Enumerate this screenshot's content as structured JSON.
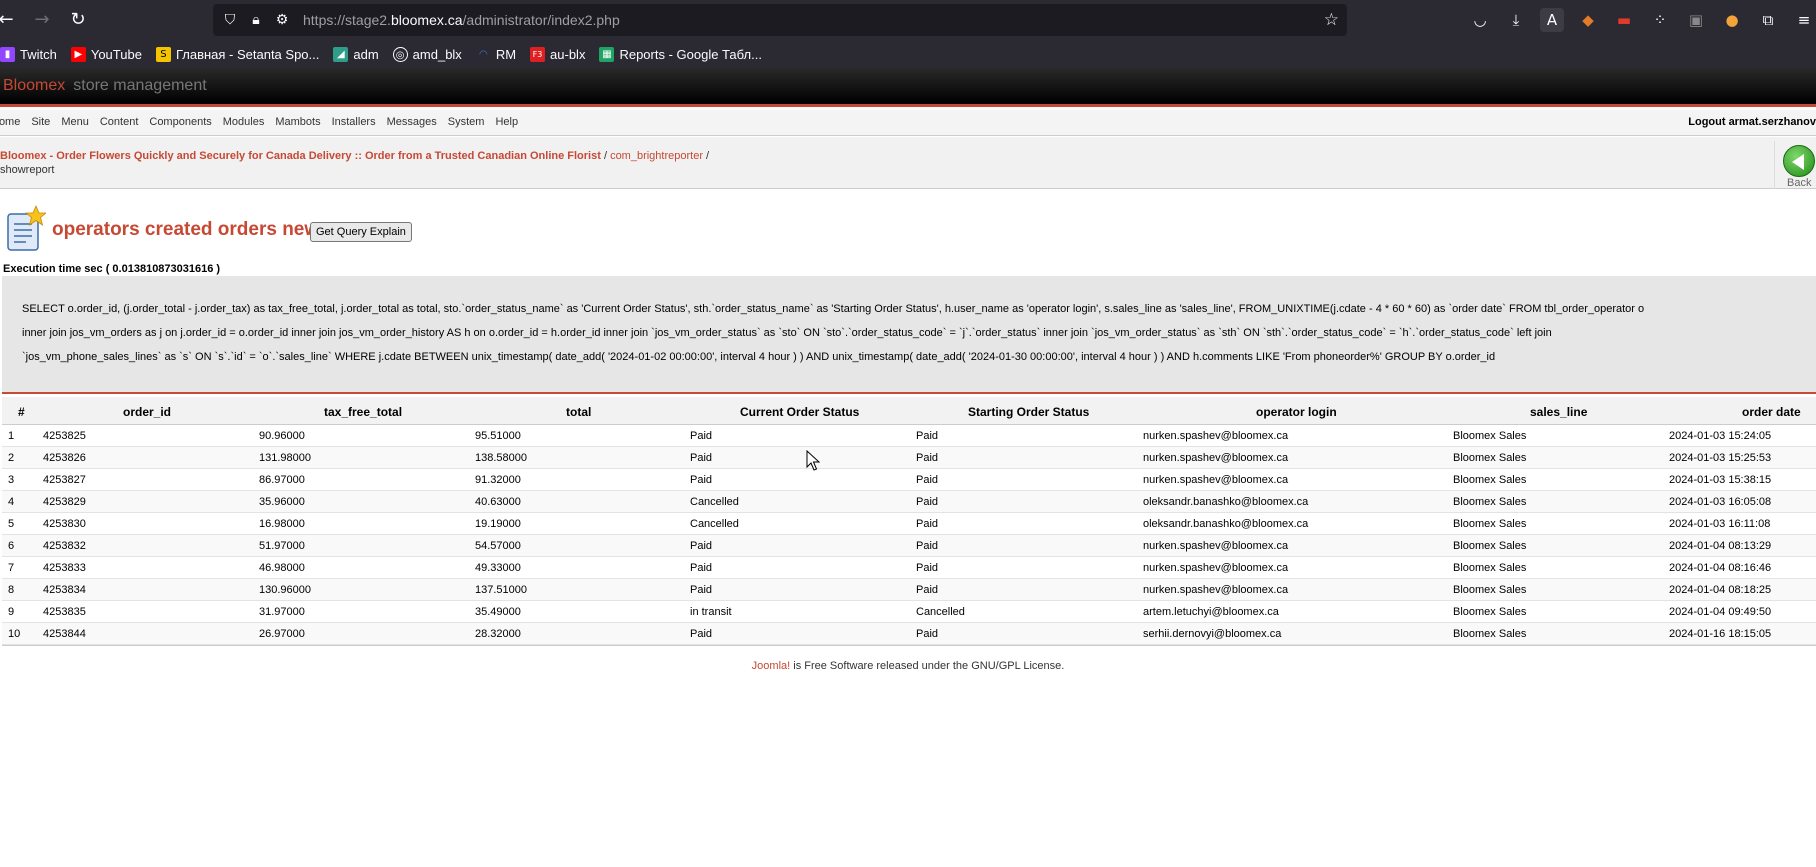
{
  "browser": {
    "url_prefix": "https://stage2.",
    "url_domain": "bloomex.ca",
    "url_suffix": "/administrator/index2.php",
    "bookmarks": [
      {
        "label": "Twitch",
        "icon": "twitch-icon",
        "color": "#9146ff"
      },
      {
        "label": "YouTube",
        "icon": "youtube-icon",
        "color": "#ff0000"
      },
      {
        "label": "Главная - Setanta Spo...",
        "icon": "setanta-icon",
        "color": "#f5c400"
      },
      {
        "label": "adm",
        "icon": "adm-icon",
        "color": "#2e9e8a"
      },
      {
        "label": "amd_blx",
        "icon": "globe-icon",
        "color": "#2b2a33"
      },
      {
        "label": "RM",
        "icon": "rm-icon",
        "color": "#4a6fd8"
      },
      {
        "label": "au-blx",
        "icon": "f3-icon",
        "color": "#e02020"
      },
      {
        "label": "Reports - Google Табл...",
        "icon": "sheets-icon",
        "color": "#1fa463"
      }
    ]
  },
  "header": {
    "brand": "Bloomex",
    "subtitle": "store management",
    "accent_color": "#c64934"
  },
  "menu": {
    "items": [
      "Home",
      "Site",
      "Menu",
      "Content",
      "Components",
      "Modules",
      "Mambots",
      "Installers",
      "Messages",
      "System",
      "Help"
    ],
    "logout": "Logout armat.serzhanov"
  },
  "pathway": {
    "site": "Bloomex - Order Flowers Quickly and Securely for Canada Delivery :: Order from a Trusted Canadian Online Florist",
    "sep1": " / ",
    "component": "com_brightreporter",
    "sep2": " /",
    "task": "showreport"
  },
  "back_label": "Back",
  "report": {
    "title": "operators created orders new",
    "explain_button": "Get Query Explain",
    "exec_time": "Execution time sec ( 0.013810873031616 )",
    "sql_lines": [
      "SELECT o.order_id, (j.order_total - j.order_tax) as tax_free_total, j.order_total as total, sto.`order_status_name` as 'Current Order Status', sth.`order_status_name` as 'Starting Order Status', h.user_name as 'operator login', s.sales_line as 'sales_line', FROM_UNIXTIME(j.cdate - 4 * 60 * 60) as `order date` FROM tbl_order_operator o",
      "inner join jos_vm_orders as j on j.order_id = o.order_id inner join jos_vm_order_history AS h on o.order_id = h.order_id inner join `jos_vm_order_status` as `sto` ON `sto`.`order_status_code` = `j`.`order_status` inner join `jos_vm_order_status` as `sth` ON `sth`.`order_status_code` = `h`.`order_status_code` left join",
      "`jos_vm_phone_sales_lines` as `s` ON `s`.`id` = `o`.`sales_line` WHERE j.cdate BETWEEN unix_timestamp( date_add( '2024-01-02 00:00:00', interval 4 hour ) ) AND unix_timestamp( date_add( '2024-01-30 00:00:00', interval 4 hour ) ) AND h.comments LIKE 'From phoneorder%' GROUP BY o.order_id"
    ]
  },
  "table": {
    "columns": [
      "#",
      "order_id",
      "tax_free_total",
      "total",
      "Current Order Status",
      "Starting Order Status",
      "operator login",
      "sales_line",
      "order date"
    ],
    "rows": [
      [
        "1",
        "4253825",
        "90.96000",
        "95.51000",
        "Paid",
        "Paid",
        "nurken.spashev@bloomex.ca",
        "Bloomex Sales",
        "2024-01-03 15:24:05"
      ],
      [
        "2",
        "4253826",
        "131.98000",
        "138.58000",
        "Paid",
        "Paid",
        "nurken.spashev@bloomex.ca",
        "Bloomex Sales",
        "2024-01-03 15:25:53"
      ],
      [
        "3",
        "4253827",
        "86.97000",
        "91.32000",
        "Paid",
        "Paid",
        "nurken.spashev@bloomex.ca",
        "Bloomex Sales",
        "2024-01-03 15:38:15"
      ],
      [
        "4",
        "4253829",
        "35.96000",
        "40.63000",
        "Cancelled",
        "Paid",
        "oleksandr.banashko@bloomex.ca",
        "Bloomex Sales",
        "2024-01-03 16:05:08"
      ],
      [
        "5",
        "4253830",
        "16.98000",
        "19.19000",
        "Cancelled",
        "Paid",
        "oleksandr.banashko@bloomex.ca",
        "Bloomex Sales",
        "2024-01-03 16:11:08"
      ],
      [
        "6",
        "4253832",
        "51.97000",
        "54.57000",
        "Paid",
        "Paid",
        "nurken.spashev@bloomex.ca",
        "Bloomex Sales",
        "2024-01-04 08:13:29"
      ],
      [
        "7",
        "4253833",
        "46.98000",
        "49.33000",
        "Paid",
        "Paid",
        "nurken.spashev@bloomex.ca",
        "Bloomex Sales",
        "2024-01-04 08:16:46"
      ],
      [
        "8",
        "4253834",
        "130.96000",
        "137.51000",
        "Paid",
        "Paid",
        "nurken.spashev@bloomex.ca",
        "Bloomex Sales",
        "2024-01-04 08:18:25"
      ],
      [
        "9",
        "4253835",
        "31.97000",
        "35.49000",
        "in transit",
        "Cancelled",
        "artem.letuchyi@bloomex.ca",
        "Bloomex Sales",
        "2024-01-04 09:49:50"
      ],
      [
        "10",
        "4253844",
        "26.97000",
        "28.32000",
        "Paid",
        "Paid",
        "serhii.dernovyi@bloomex.ca",
        "Bloomex Sales",
        "2024-01-16 18:15:05"
      ]
    ]
  },
  "footer": {
    "link": "Joomla!",
    "text": " is Free Software released under the GNU/GPL License."
  }
}
